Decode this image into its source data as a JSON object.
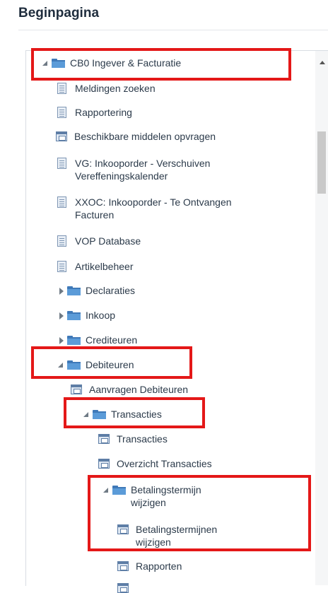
{
  "header": {
    "title": "Beginpagina"
  },
  "tree": {
    "root": "CB0 Ingever & Facturatie",
    "items": {
      "meldingen": "Meldingen zoeken",
      "rapportering": "Rapportering",
      "middelen": "Beschikbare middelen opvragen",
      "vg": "VG: Inkooporder - Verschuiven Vereffeningskalender",
      "xxoc": "XXOC: Inkooporder - Te Ontvangen Facturen",
      "vop": "VOP Database",
      "artikel": "Artikelbeheer",
      "declaraties": "Declaraties",
      "inkoop": "Inkoop",
      "crediteuren": "Crediteuren",
      "debiteuren": "Debiteuren",
      "aanvragen": "Aanvragen Debiteuren",
      "transacties_folder": "Transacties",
      "transacties": "Transacties",
      "overzicht": "Overzicht Transacties",
      "betalingstermijn_folder": "Betalingstermijn wijzigen",
      "betalingstermijnen": "Betalingstermijnen wijzigen",
      "rapporten": "Rapporten"
    }
  },
  "icons": {
    "folder": "folder-icon",
    "document": "document-icon",
    "form": "form-icon",
    "expanded": "caret-expanded-icon",
    "collapsed": "caret-collapsed-icon"
  },
  "colors": {
    "highlight": "#e41818",
    "folder": "#5b9bd8",
    "text": "#2b3a4a"
  }
}
